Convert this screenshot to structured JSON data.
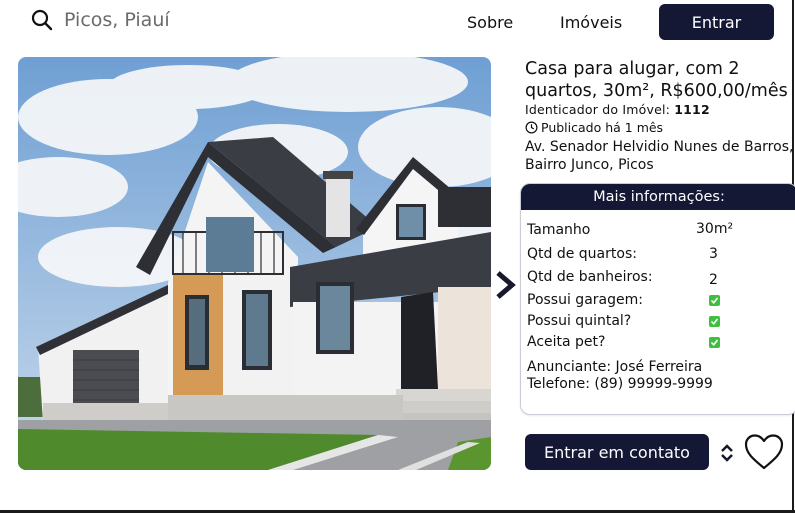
{
  "header": {
    "search": {
      "placeholder": "Picos, Piauí",
      "icon": "search-icon"
    },
    "nav": [
      {
        "label": "Sobre"
      },
      {
        "label": "Imóveis"
      }
    ],
    "login_label": "Entrar"
  },
  "listing": {
    "title": "Casa para alugar, com 2 quartos, 30m², R$600,00/mês",
    "id_label": "Identicador do Imóvel:",
    "id_value": "1112",
    "published": "Publicado há 1 mês",
    "address": "Av. Senador Helvidio Nunes de Barros, Bairro Junco, Picos"
  },
  "info": {
    "header": "Mais informações:",
    "specs": [
      {
        "label": "Tamanho",
        "value": "30m²"
      },
      {
        "label": "Qtd de quartos:",
        "value": "3"
      },
      {
        "label": "Qtd de banheiros:",
        "value": "2"
      }
    ],
    "features": [
      {
        "label": "Possui garagem:",
        "checked": true
      },
      {
        "label": "Possui quintal?",
        "checked": true
      },
      {
        "label": "Aceita pet?",
        "checked": true
      }
    ],
    "advertiser": "Anunciante: José Ferreira",
    "phone": "Telefone: (89) 99999-9999"
  },
  "actions": {
    "contact_label": "Entrar em contato"
  },
  "colors": {
    "primary": "#141834",
    "check": "#3fbf3f"
  }
}
